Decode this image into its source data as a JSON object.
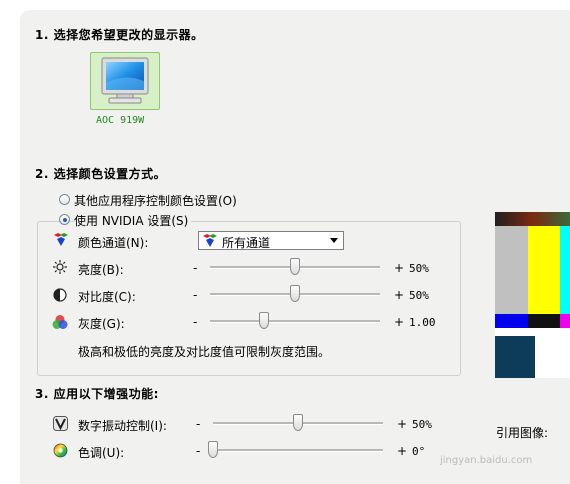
{
  "section1": {
    "heading": "1. 选择您希望更改的显示器。",
    "monitor_label": "AOC 919W"
  },
  "section2": {
    "heading": "2. 选择颜色设置方式。",
    "option_other": "其他应用程序控制颜色设置(O)",
    "option_nvidia": "使用 NVIDIA 设置(S)",
    "channel_label": "颜色通道(N):",
    "channel_value": "所有通道",
    "brightness_label": "亮度(B):",
    "brightness_value": "50%",
    "brightness_level": 0.5,
    "contrast_label": "对比度(C):",
    "contrast_value": "50%",
    "contrast_level": 0.5,
    "gamma_label": "灰度(G):",
    "gamma_value": "1.00",
    "gamma_level": 0.32,
    "note": "极高和极低的亮度及对比度值可限制灰度范围。",
    "minus": "-",
    "plus": "+"
  },
  "section3": {
    "heading": "3. 应用以下增强功能:",
    "vibrance_label": "数字振动控制(I):",
    "vibrance_value": "50%",
    "vibrance_level": 0.5,
    "hue_label": "色调(U):",
    "hue_value": "0°",
    "hue_level": 0.0,
    "reference_label": "引用图像:"
  },
  "watermark": "jingyan.baidu.com",
  "colors": {
    "panel": "#f1f1ef",
    "monitor_highlight": "#d8f0c8",
    "monitor_label": "#228822"
  }
}
